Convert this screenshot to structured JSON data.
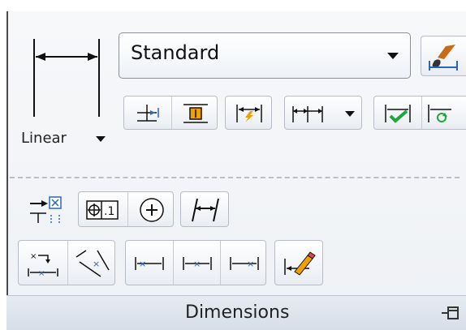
{
  "ribbon": {
    "panel_title": "Dimensions",
    "linear_label": "Linear",
    "style_selector": {
      "value": "Standard"
    }
  },
  "icons": {
    "linear": "linear-dimension-icon",
    "dimstyle": "dimension-style-brush-icon",
    "quickdim": "quick-dimension-icon",
    "baseline": "baseline-icon",
    "continue": "continue-icon",
    "update": "update-icon",
    "override": "override-icon",
    "tolerance": "tolerance-icon",
    "center": "center-mark-icon",
    "oblique": "oblique-icon",
    "editpencil": "dimension-edit-pencil-icon",
    "pin": "pin-icon"
  },
  "colors": {
    "accent_blue": "#2a66b8",
    "accent_green": "#22a53c",
    "accent_orange": "#f0a000"
  }
}
